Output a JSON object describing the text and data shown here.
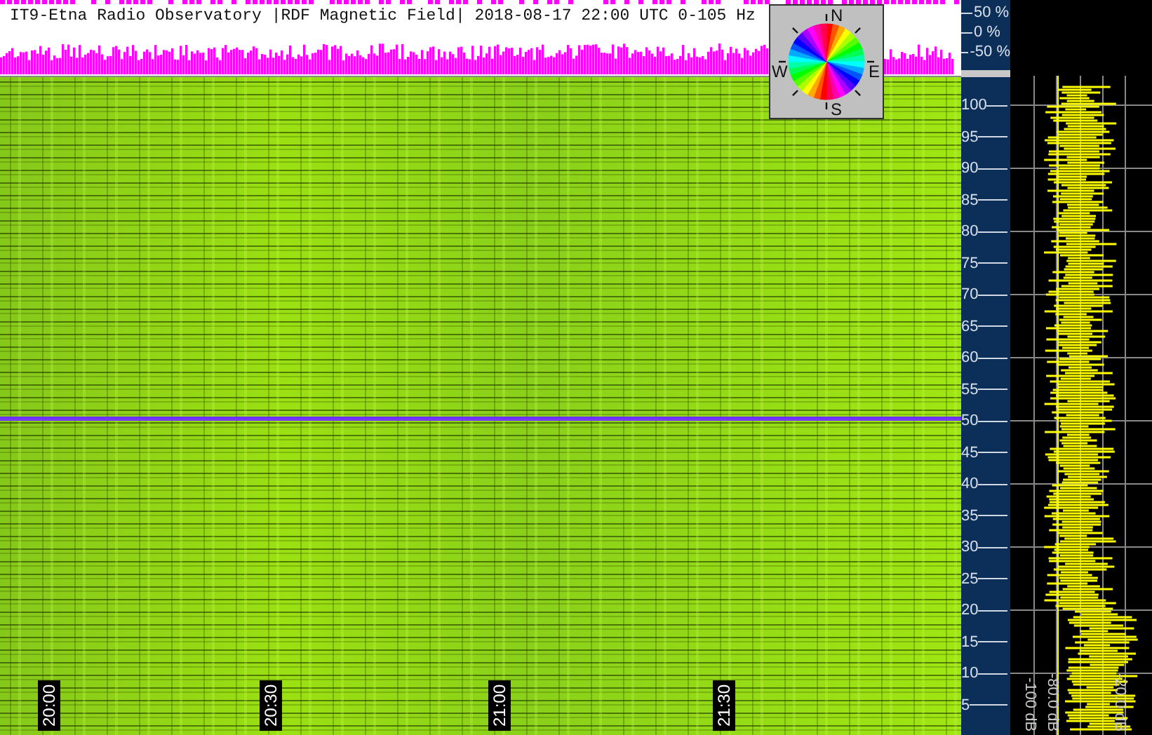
{
  "title": "IT9-Etna Radio Observatory |RDF Magnetic Field| 2018-08-17 22:00 UTC 0-105 Hz",
  "compass": {
    "north": "N",
    "east": "E",
    "south": "S",
    "west": "W"
  },
  "percent_scale": [
    "50 %",
    "0 %",
    "-50 %"
  ],
  "frequency_scale": [
    "100",
    "95",
    "90",
    "85",
    "80",
    "75",
    "70",
    "65",
    "60",
    "55",
    "50",
    "45",
    "40",
    "35",
    "30",
    "25",
    "20",
    "15",
    "10",
    "5"
  ],
  "time_labels": [
    "20:00",
    "20:30",
    "21:00",
    "21:30"
  ],
  "db_labels": [
    "-100 dB",
    "-80.0 dB",
    "-20.0 dB"
  ]
}
